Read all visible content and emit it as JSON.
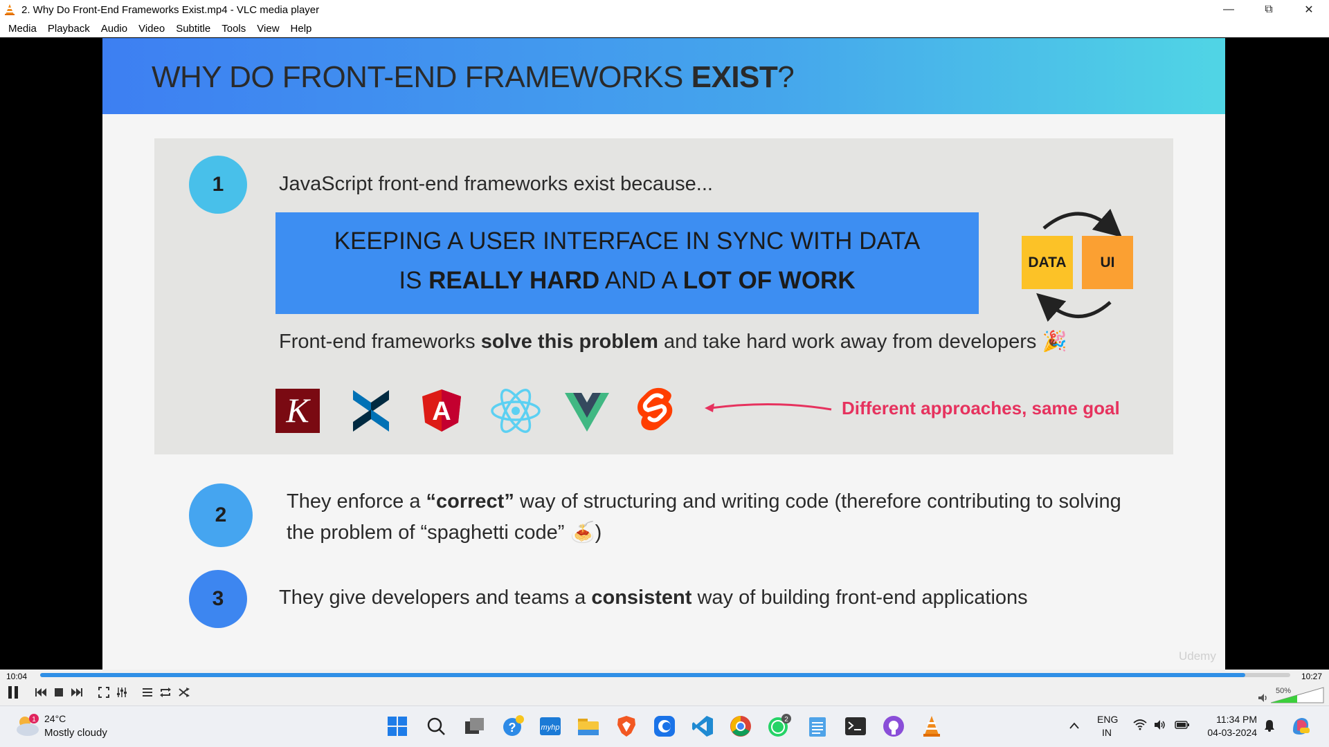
{
  "window": {
    "title": "2. Why Do Front-End Frameworks Exist.mp4 - VLC media player"
  },
  "menu": [
    "Media",
    "Playback",
    "Audio",
    "Video",
    "Subtitle",
    "Tools",
    "View",
    "Help"
  ],
  "slide": {
    "title_normal": "WHY DO FRONT-END FRAMEWORKS ",
    "title_bold": "EXIST",
    "title_end": "?",
    "point1_num": "1",
    "point1_text": "JavaScript front-end frameworks exist because...",
    "box_line1": "KEEPING A USER INTERFACE IN SYNC WITH DATA",
    "box_line2_a": "IS ",
    "box_line2_b": "REALLY HARD",
    "box_line2_c": " AND A ",
    "box_line2_d": "LOT OF WORK",
    "data_label": "DATA",
    "ui_label": "UI",
    "solve_a": "Front-end frameworks ",
    "solve_b": "solve this problem",
    "solve_c": " and take hard work away from developers",
    "solve_emoji": "🎉",
    "approaches": "Different approaches, same goal",
    "point2_num": "2",
    "point2_a": "They enforce a ",
    "point2_b": "“correct”",
    "point2_c": " way of structuring and writing code (therefore contributing to solving the problem of “spaghetti code” ",
    "point2_emoji": "🍝",
    "point2_d": ")",
    "point3_num": "3",
    "point3_a": "They give developers and teams a ",
    "point3_b": "consistent",
    "point3_c": " way of building front-end applications",
    "watermark": "Udemy"
  },
  "framework_logos": [
    "knockout-logo-icon",
    "backbone-logo-icon",
    "angular-logo-icon",
    "react-logo-icon",
    "vue-logo-icon",
    "svelte-logo-icon"
  ],
  "player": {
    "time_elapsed": "10:04",
    "time_total": "10:27",
    "progress_fraction": 0.964,
    "volume": "50%"
  },
  "taskbar": {
    "weather_temp": "24°C",
    "weather_desc": "Mostly cloudy",
    "weather_badge": "1",
    "whatsapp_badge": "2",
    "lang_line1": "ENG",
    "lang_line2": "IN",
    "time": "11:34 PM",
    "date": "04-03-2024"
  },
  "colors": {
    "header_gradient_start": "#3d7ff2",
    "header_gradient_end": "#50d5e5",
    "accent_red": "#e6325e",
    "data_box": "#fcc227",
    "ui_box": "#fba032",
    "seek_fill": "#2f8fe6"
  }
}
